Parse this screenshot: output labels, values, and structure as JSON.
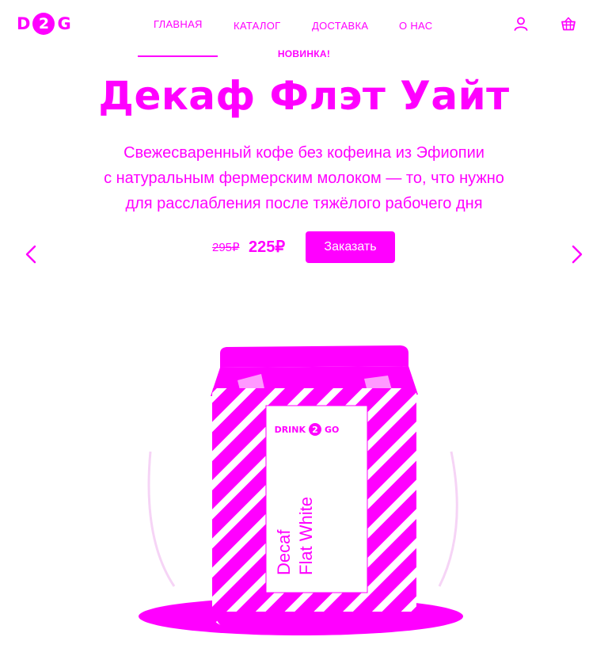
{
  "brand": {
    "logo_left": "D",
    "logo_mark": "2",
    "logo_right": "G"
  },
  "nav": {
    "items": [
      {
        "label": "ГЛАВНАЯ"
      },
      {
        "label": "КАТАЛОГ"
      },
      {
        "label": "ДОСТАВКА"
      },
      {
        "label": "О НАС"
      }
    ]
  },
  "icons": {
    "account": "user-icon",
    "cart": "basket-icon",
    "prev": "chevron-left-icon",
    "next": "chevron-right-icon"
  },
  "hero": {
    "badge": "НОВИНКА!",
    "title": "Декаф Флэт Уайт",
    "description": [
      "Свежесваренный кофе без кофеина из Эфиопии",
      "с натуральным фермерским молоком — то, что нужно",
      "для расслабления после тяжёлого рабочего дня"
    ],
    "old_price": "295₽",
    "new_price": "225₽",
    "order_label": "Заказать"
  },
  "product": {
    "brand_left": "DRINK",
    "brand_mark": "2",
    "brand_right": "GO",
    "name_line1": "Decaf",
    "name_line2": "Flat White"
  },
  "colors": {
    "accent": "#ff00ff",
    "background": "#ffffff"
  }
}
